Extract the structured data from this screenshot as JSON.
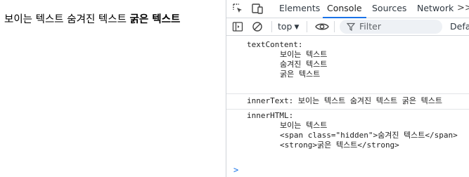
{
  "page": {
    "text_visible": "보이는 텍스트",
    "text_hidden": "숨겨진 텍스트",
    "text_bold": "굵은 텍스트"
  },
  "devtools": {
    "tabs": [
      {
        "label": "Elements"
      },
      {
        "label": "Console"
      },
      {
        "label": "Sources"
      },
      {
        "label": "Network"
      }
    ],
    "more_tabs_label": ">>",
    "toolbar": {
      "context": "top",
      "filter_placeholder": "Filter",
      "levels_label": "Defau"
    },
    "console": {
      "text_content": {
        "label": "textContent:",
        "lines": [
          "보이는 텍스트",
          "숨겨진 텍스트",
          "굵은 텍스트"
        ]
      },
      "inner_text": {
        "line": "innerText: 보이는 텍스트 숨겨진 텍스트 굵은 텍스트"
      },
      "inner_html": {
        "label": "innerHTML:",
        "lines": [
          "보이는 텍스트",
          "<span class=\"hidden\">숨겨진 텍스트</span>",
          "<strong>굵은 텍스트</strong>"
        ]
      },
      "prompt": ">"
    }
  },
  "colors": {
    "accent": "#1a73e8",
    "active_tab_underline": "#1a73e8",
    "filter_bg": "#eef1f5"
  }
}
